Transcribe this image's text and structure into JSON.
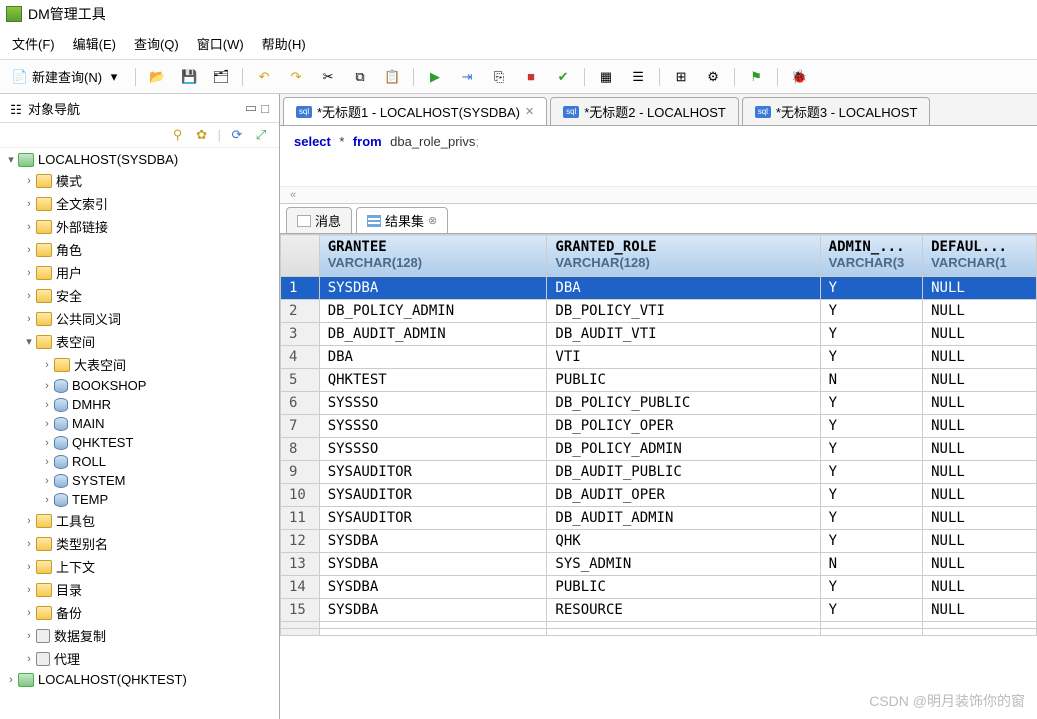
{
  "app": {
    "title": "DM管理工具"
  },
  "menu": {
    "file": "文件(F)",
    "edit": "编辑(E)",
    "query": "查询(Q)",
    "window": "窗口(W)",
    "help": "帮助(H)"
  },
  "toolbar": {
    "new_query": "新建查询(N)"
  },
  "sidebar": {
    "title": "对象导航",
    "root": "LOCALHOST(SYSDBA)",
    "root2": "LOCALHOST(QHKTEST)",
    "items": [
      "模式",
      "全文索引",
      "外部链接",
      "角色",
      "用户",
      "安全",
      "公共同义词"
    ],
    "tablespace": {
      "label": "表空间",
      "big": "大表空间",
      "children": [
        "BOOKSHOP",
        "DMHR",
        "MAIN",
        "QHKTEST",
        "ROLL",
        "SYSTEM",
        "TEMP"
      ]
    },
    "tail": [
      "工具包",
      "类型别名",
      "上下文",
      "目录",
      "备份",
      "数据复制",
      "代理"
    ]
  },
  "editor": {
    "tabs": [
      "*无标题1 - LOCALHOST(SYSDBA)",
      "*无标题2 - LOCALHOST",
      "*无标题3 - LOCALHOST"
    ],
    "sql_prefix": "select * from ",
    "sql_ident": "dba_role_privs",
    "sql_semi": ";",
    "collapse": "«"
  },
  "result_tabs": {
    "msg": "消息",
    "grid": "结果集"
  },
  "grid": {
    "cols": [
      {
        "name": "GRANTEE",
        "type": "VARCHAR(128)"
      },
      {
        "name": "GRANTED_ROLE",
        "type": "VARCHAR(128)"
      },
      {
        "name": "ADMIN_...",
        "type": "VARCHAR(3"
      },
      {
        "name": "DEFAUL...",
        "type": "VARCHAR(1"
      }
    ],
    "rows": [
      [
        "SYSDBA",
        "DBA",
        "Y",
        "NULL"
      ],
      [
        "DB_POLICY_ADMIN",
        "DB_POLICY_VTI",
        "Y",
        "NULL"
      ],
      [
        "DB_AUDIT_ADMIN",
        "DB_AUDIT_VTI",
        "Y",
        "NULL"
      ],
      [
        "DBA",
        "VTI",
        "Y",
        "NULL"
      ],
      [
        "QHKTEST",
        "PUBLIC",
        "N",
        "NULL"
      ],
      [
        "SYSSSO",
        "DB_POLICY_PUBLIC",
        "Y",
        "NULL"
      ],
      [
        "SYSSSO",
        "DB_POLICY_OPER",
        "Y",
        "NULL"
      ],
      [
        "SYSSSO",
        "DB_POLICY_ADMIN",
        "Y",
        "NULL"
      ],
      [
        "SYSAUDITOR",
        "DB_AUDIT_PUBLIC",
        "Y",
        "NULL"
      ],
      [
        "SYSAUDITOR",
        "DB_AUDIT_OPER",
        "Y",
        "NULL"
      ],
      [
        "SYSAUDITOR",
        "DB_AUDIT_ADMIN",
        "Y",
        "NULL"
      ],
      [
        "SYSDBA",
        "QHK",
        "Y",
        "NULL"
      ],
      [
        "SYSDBA",
        "SYS_ADMIN",
        "N",
        "NULL"
      ],
      [
        "SYSDBA",
        "PUBLIC",
        "Y",
        "NULL"
      ],
      [
        "SYSDBA",
        "RESOURCE",
        "Y",
        "NULL"
      ]
    ]
  },
  "watermark": "CSDN @明月装饰你的窗"
}
